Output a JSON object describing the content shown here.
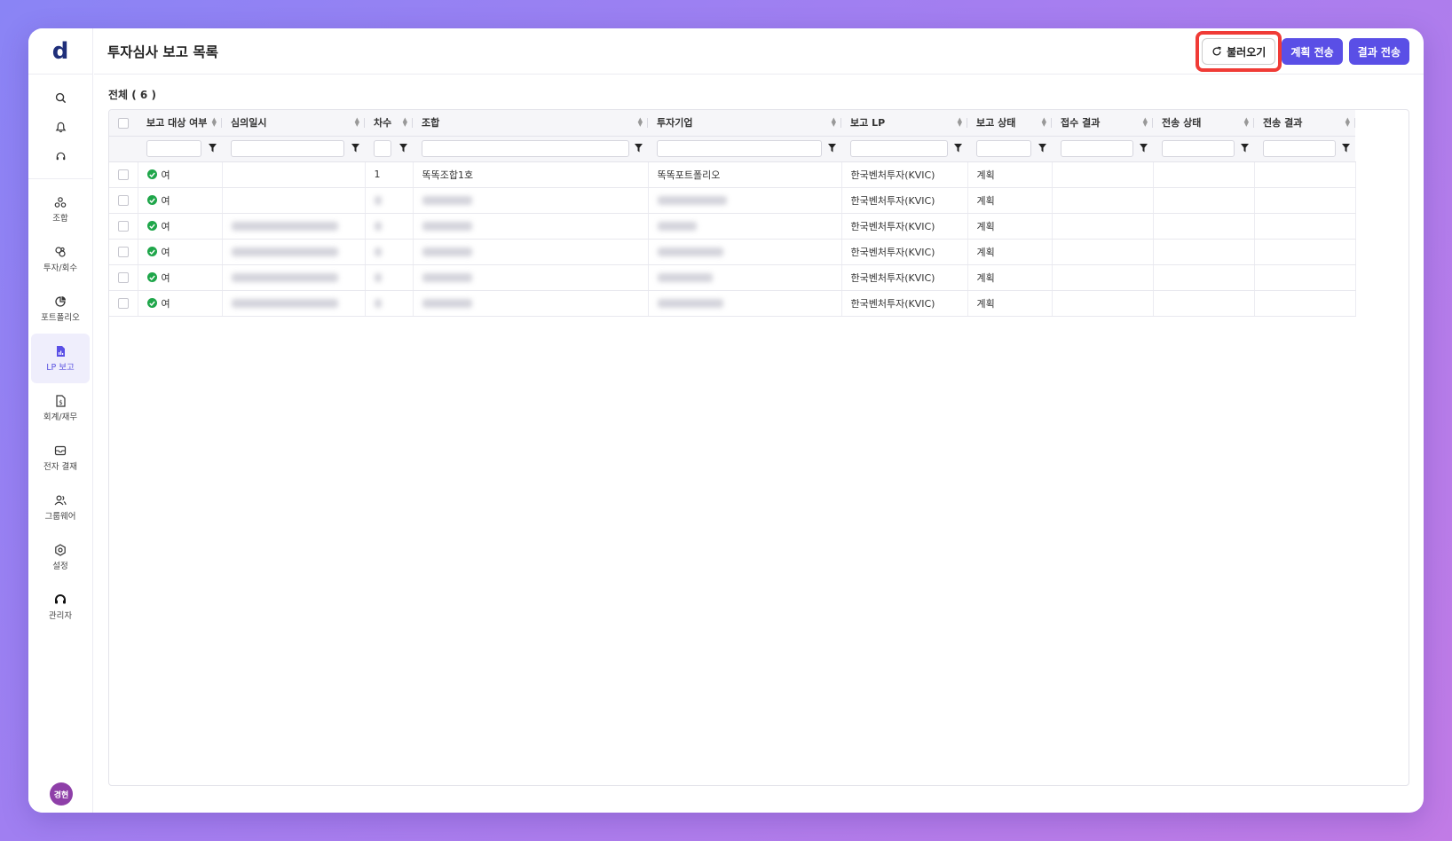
{
  "app": {
    "logo": "d"
  },
  "sidebar": {
    "quick": [
      {
        "name": "search-icon"
      },
      {
        "name": "bell-icon"
      },
      {
        "name": "headset-icon"
      }
    ],
    "items": [
      {
        "label": "조합",
        "icon": "fund-icon"
      },
      {
        "label": "투자/회수",
        "icon": "invest-icon"
      },
      {
        "label": "포트폴리오",
        "icon": "portfolio-icon"
      },
      {
        "label": "LP 보고",
        "icon": "lp-report-icon",
        "active": true
      },
      {
        "label": "회계/재무",
        "icon": "accounting-icon"
      },
      {
        "label": "전자 결재",
        "icon": "approval-icon"
      },
      {
        "label": "그룹웨어",
        "icon": "groupware-icon"
      },
      {
        "label": "설정",
        "icon": "settings-icon"
      },
      {
        "label": "관리자",
        "icon": "admin-icon"
      }
    ],
    "avatar": "경현"
  },
  "header": {
    "title": "투자심사 보고 목록",
    "load_button": "불러오기",
    "plan_send_button": "계획 전송",
    "result_send_button": "결과 전송"
  },
  "summary": {
    "count_label": "전체 ( 6 )"
  },
  "table": {
    "columns": [
      "보고 대상 여부",
      "심의일시",
      "차수",
      "조합",
      "투자기업",
      "보고 LP",
      "보고 상태",
      "접수 결과",
      "전송 상태",
      "전송 결과"
    ],
    "rows": [
      {
        "target": "여",
        "date": "",
        "round": "1",
        "fund": "똑똑조합1호",
        "company": "똑똑포트폴리오",
        "lp": "한국벤처투자(KVIC)",
        "status": "계획",
        "recv": "",
        "send_status": "",
        "send_result": "",
        "blurred": false
      },
      {
        "target": "여",
        "date": "",
        "round": "",
        "fund": "",
        "company": "",
        "lp": "한국벤처투자(KVIC)",
        "status": "계획",
        "recv": "",
        "send_status": "",
        "send_result": "",
        "blurred": true
      },
      {
        "target": "여",
        "date": "",
        "round": "",
        "fund": "",
        "company": "",
        "lp": "한국벤처투자(KVIC)",
        "status": "계획",
        "recv": "",
        "send_status": "",
        "send_result": "",
        "blurred": true
      },
      {
        "target": "여",
        "date": "",
        "round": "",
        "fund": "",
        "company": "",
        "lp": "한국벤처투자(KVIC)",
        "status": "계획",
        "recv": "",
        "send_status": "",
        "send_result": "",
        "blurred": true
      },
      {
        "target": "여",
        "date": "",
        "round": "",
        "fund": "",
        "company": "",
        "lp": "한국벤처투자(KVIC)",
        "status": "계획",
        "recv": "",
        "send_status": "",
        "send_result": "",
        "blurred": true
      },
      {
        "target": "여",
        "date": "",
        "round": "",
        "fund": "",
        "company": "",
        "lp": "한국벤처투자(KVIC)",
        "status": "계획",
        "recv": "",
        "send_status": "",
        "send_result": "",
        "blurred": true
      }
    ]
  },
  "colors": {
    "primary": "#5a4fe6",
    "highlight": "#f03b36",
    "success": "#1fa64a"
  }
}
